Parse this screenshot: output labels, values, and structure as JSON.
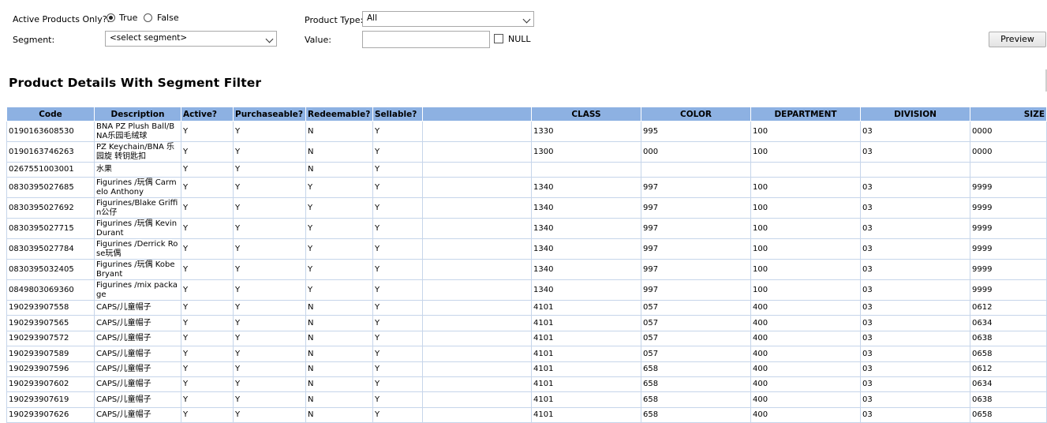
{
  "filters": {
    "active_label": "Active Products Only?:",
    "true_label": "True",
    "false_label": "False",
    "segment_label": "Segment:",
    "segment_value": "<select segment>",
    "product_type_label": "Product Type:",
    "product_type_value": "All",
    "value_label": "Value:",
    "value_input": "",
    "null_label": "NULL",
    "preview_label": "Preview"
  },
  "title": "Product Details With Segment Filter",
  "table": {
    "headers": [
      "Code",
      "Description",
      "Active?",
      "Purchaseable?",
      "Redeemable?",
      "Sellable?",
      "",
      "CLASS",
      "COLOR",
      "DEPARTMENT",
      "DIVISION",
      "SIZE"
    ],
    "rows": [
      [
        "0190163608530",
        "BNA PZ Plush Ball/BNA乐园毛绒球",
        "Y",
        "Y",
        "N",
        "Y",
        "",
        "1330",
        "995",
        "100",
        "03",
        "0000"
      ],
      [
        "0190163746263",
        "PZ Keychain/BNA 乐园旋 转钥匙扣",
        "Y",
        "Y",
        "N",
        "Y",
        "",
        "1300",
        "000",
        "100",
        "03",
        "0000"
      ],
      [
        "0267551003001",
        "水果",
        "Y",
        "Y",
        "N",
        "Y",
        "",
        "",
        "",
        "",
        "",
        ""
      ],
      [
        "0830395027685",
        "Figurines /玩偶 Carmelo Anthony",
        "Y",
        "Y",
        "Y",
        "Y",
        "",
        "1340",
        "997",
        "100",
        "03",
        "9999"
      ],
      [
        "0830395027692",
        "Figurines/Blake Griffin公仔",
        "Y",
        "Y",
        "Y",
        "Y",
        "",
        "1340",
        "997",
        "100",
        "03",
        "9999"
      ],
      [
        "0830395027715",
        "Figurines /玩偶 Kevin Durant",
        "Y",
        "Y",
        "Y",
        "Y",
        "",
        "1340",
        "997",
        "100",
        "03",
        "9999"
      ],
      [
        "0830395027784",
        "Figurines /Derrick Rose玩偶",
        "Y",
        "Y",
        "Y",
        "Y",
        "",
        "1340",
        "997",
        "100",
        "03",
        "9999"
      ],
      [
        "0830395032405",
        "Figurines /玩偶 Kobe Bryant",
        "Y",
        "Y",
        "Y",
        "Y",
        "",
        "1340",
        "997",
        "100",
        "03",
        "9999"
      ],
      [
        "0849803069360",
        "Figurines /mix package",
        "Y",
        "Y",
        "Y",
        "Y",
        "",
        "1340",
        "997",
        "100",
        "03",
        "9999"
      ],
      [
        "190293907558",
        "CAPS/儿童帽子",
        "Y",
        "Y",
        "N",
        "Y",
        "",
        "4101",
        "057",
        "400",
        "03",
        "0612"
      ],
      [
        "190293907565",
        "CAPS/儿童帽子",
        "Y",
        "Y",
        "N",
        "Y",
        "",
        "4101",
        "057",
        "400",
        "03",
        "0634"
      ],
      [
        "190293907572",
        "CAPS/儿童帽子",
        "Y",
        "Y",
        "N",
        "Y",
        "",
        "4101",
        "057",
        "400",
        "03",
        "0638"
      ],
      [
        "190293907589",
        "CAPS/儿童帽子",
        "Y",
        "Y",
        "N",
        "Y",
        "",
        "4101",
        "057",
        "400",
        "03",
        "0658"
      ],
      [
        "190293907596",
        "CAPS/儿童帽子",
        "Y",
        "Y",
        "N",
        "Y",
        "",
        "4101",
        "658",
        "400",
        "03",
        "0612"
      ],
      [
        "190293907602",
        "CAPS/儿童帽子",
        "Y",
        "Y",
        "N",
        "Y",
        "",
        "4101",
        "658",
        "400",
        "03",
        "0634"
      ],
      [
        "190293907619",
        "CAPS/儿童帽子",
        "Y",
        "Y",
        "N",
        "Y",
        "",
        "4101",
        "658",
        "400",
        "03",
        "0638"
      ],
      [
        "190293907626",
        "CAPS/儿童帽子",
        "Y",
        "Y",
        "N",
        "Y",
        "",
        "4101",
        "658",
        "400",
        "03",
        "0658"
      ]
    ]
  },
  "colors": {
    "header_bg": "#8db1e2",
    "grid_line": "#c6d5ea"
  }
}
